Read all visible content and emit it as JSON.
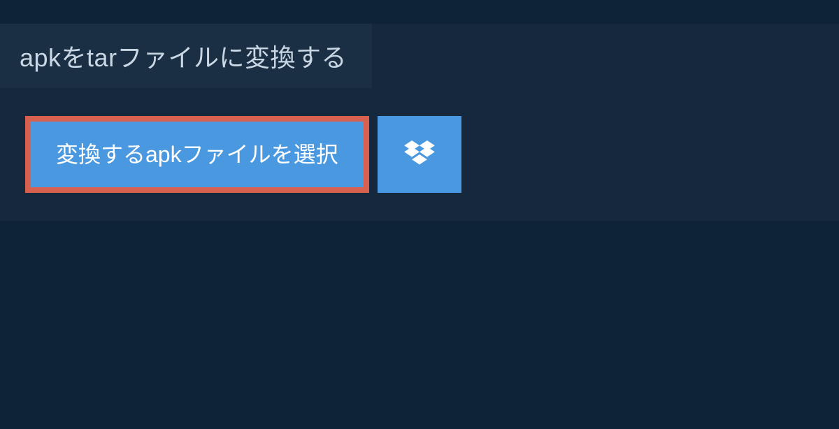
{
  "title": "apkをtarファイルに変換する",
  "select_button_label": "変換するapkファイルを選択",
  "colors": {
    "page_bg": "#0f2336",
    "panel_bg": "#15283c",
    "title_bg": "#1a2f44",
    "title_text": "#c9d6e3",
    "button_bg": "#4a99e0",
    "button_border": "#d8604f",
    "button_text": "#ffffff"
  }
}
